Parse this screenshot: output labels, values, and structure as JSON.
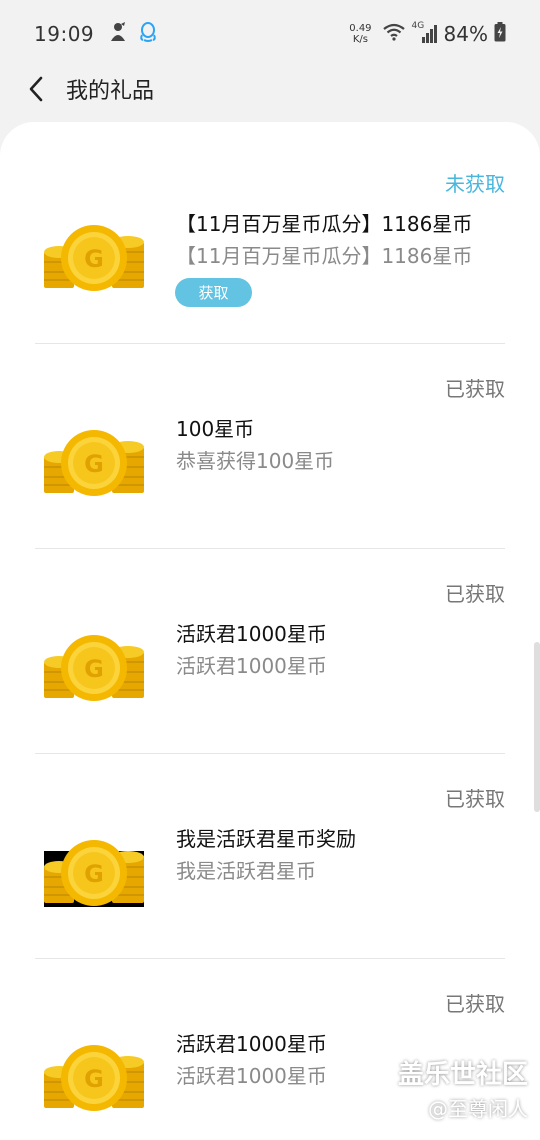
{
  "status_bar": {
    "time": "19:09",
    "net_speed_value": "0.49",
    "net_speed_unit": "K/s",
    "network_type": "4G",
    "battery_percent": "84%"
  },
  "header": {
    "title": "我的礼品"
  },
  "gifts": [
    {
      "status": "未获取",
      "title": "【11月百万星币瓜分】1186星币",
      "description": "【11月百万星币瓜分】1186星币",
      "action_label": "获取"
    },
    {
      "status": "已获取",
      "title": "100星币",
      "description": "恭喜获得100星币"
    },
    {
      "status": "已获取",
      "title": "活跃君1000星币",
      "description": "活跃君1000星币"
    },
    {
      "status": "已获取",
      "title": "我是活跃君星币奖励",
      "description": "我是活跃君星币"
    },
    {
      "status": "已获取",
      "title": "活跃君1000星币",
      "description": "活跃君1000星币"
    }
  ],
  "watermark": {
    "line1": "盖乐世社区",
    "line2": "@至尊闲人"
  },
  "colors": {
    "accent": "#47b7de",
    "button": "#62c3e3",
    "coin": "#f5c518"
  }
}
